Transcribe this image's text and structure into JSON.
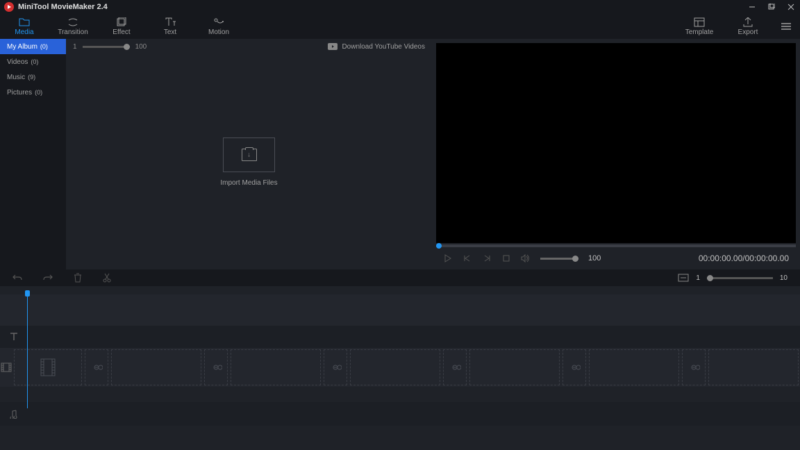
{
  "title": "MiniTool MovieMaker 2.4",
  "toolbar": {
    "media": "Media",
    "transition": "Transition",
    "effect": "Effect",
    "text": "Text",
    "motion": "Motion",
    "template": "Template",
    "export": "Export"
  },
  "sidebar": {
    "items": [
      {
        "label": "My Album",
        "count": "(0)"
      },
      {
        "label": "Videos",
        "count": "(0)"
      },
      {
        "label": "Music",
        "count": "(9)"
      },
      {
        "label": "Pictures",
        "count": "(0)"
      }
    ]
  },
  "media": {
    "zoom_min": "1",
    "zoom_max": "100",
    "download": "Download YouTube Videos",
    "import": "Import Media Files"
  },
  "preview": {
    "volume": "100",
    "time": "00:00:00.00/00:00:00.00"
  },
  "timeline": {
    "zoom_min": "1",
    "zoom_max": "10"
  }
}
